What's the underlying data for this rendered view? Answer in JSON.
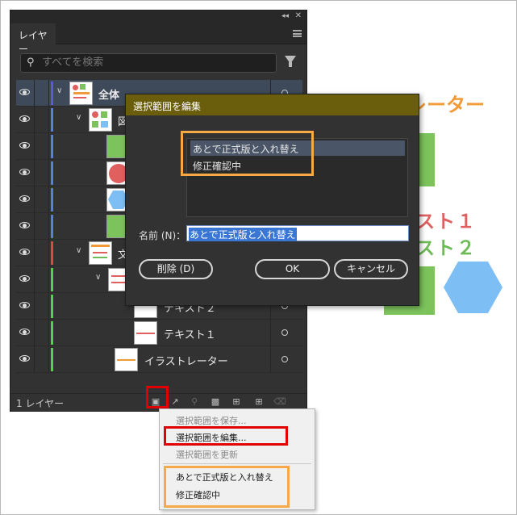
{
  "artboard": {
    "title": "イラストレーター",
    "title_visible": "レーター",
    "text1_visible": "スト１",
    "text2_visible": "スト２"
  },
  "panel": {
    "tab_label": "レイヤー",
    "search_placeholder": "すべてを検索",
    "layers_count": "1 レイヤー",
    "rows": [
      {
        "name": "全体",
        "color": "#5a5adb"
      },
      {
        "name": "図",
        "color": "#5a7fdb"
      },
      {
        "name": "",
        "color": "#5a7fdb"
      },
      {
        "name": "",
        "color": "#5a7fdb"
      },
      {
        "name": "",
        "color": "#5a7fdb"
      },
      {
        "name": "",
        "color": "#5a7fdb"
      },
      {
        "name": "文",
        "color": "#e04848"
      },
      {
        "name": "",
        "color": "#4dd54d"
      },
      {
        "name": "テキスト２",
        "color": "#4dd54d"
      },
      {
        "name": "テキスト１",
        "color": "#4dd54d"
      },
      {
        "name": "イラストレーター",
        "color": "#4dd54d"
      }
    ]
  },
  "menu": {
    "save_selection": "選択範囲を保存...",
    "edit_selection": "選択範囲を編集...",
    "update_selection": "選択範囲を更新",
    "item1": "あとで正式版と入れ替え",
    "item2": "修正確認中"
  },
  "dialog": {
    "title": "選択範囲を編集",
    "list": [
      "あとで正式版と入れ替え",
      "修正確認中"
    ],
    "name_label": "名前 (N)：",
    "name_value": "あとで正式版と入れ替え",
    "delete_label": "削除 (D)",
    "ok_label": "OK",
    "cancel_label": "キャンセル"
  },
  "colors": {
    "dialog_title_bg": "#6a5e0d",
    "highlight_red": "#e00000",
    "highlight_orange": "#f7a948"
  }
}
